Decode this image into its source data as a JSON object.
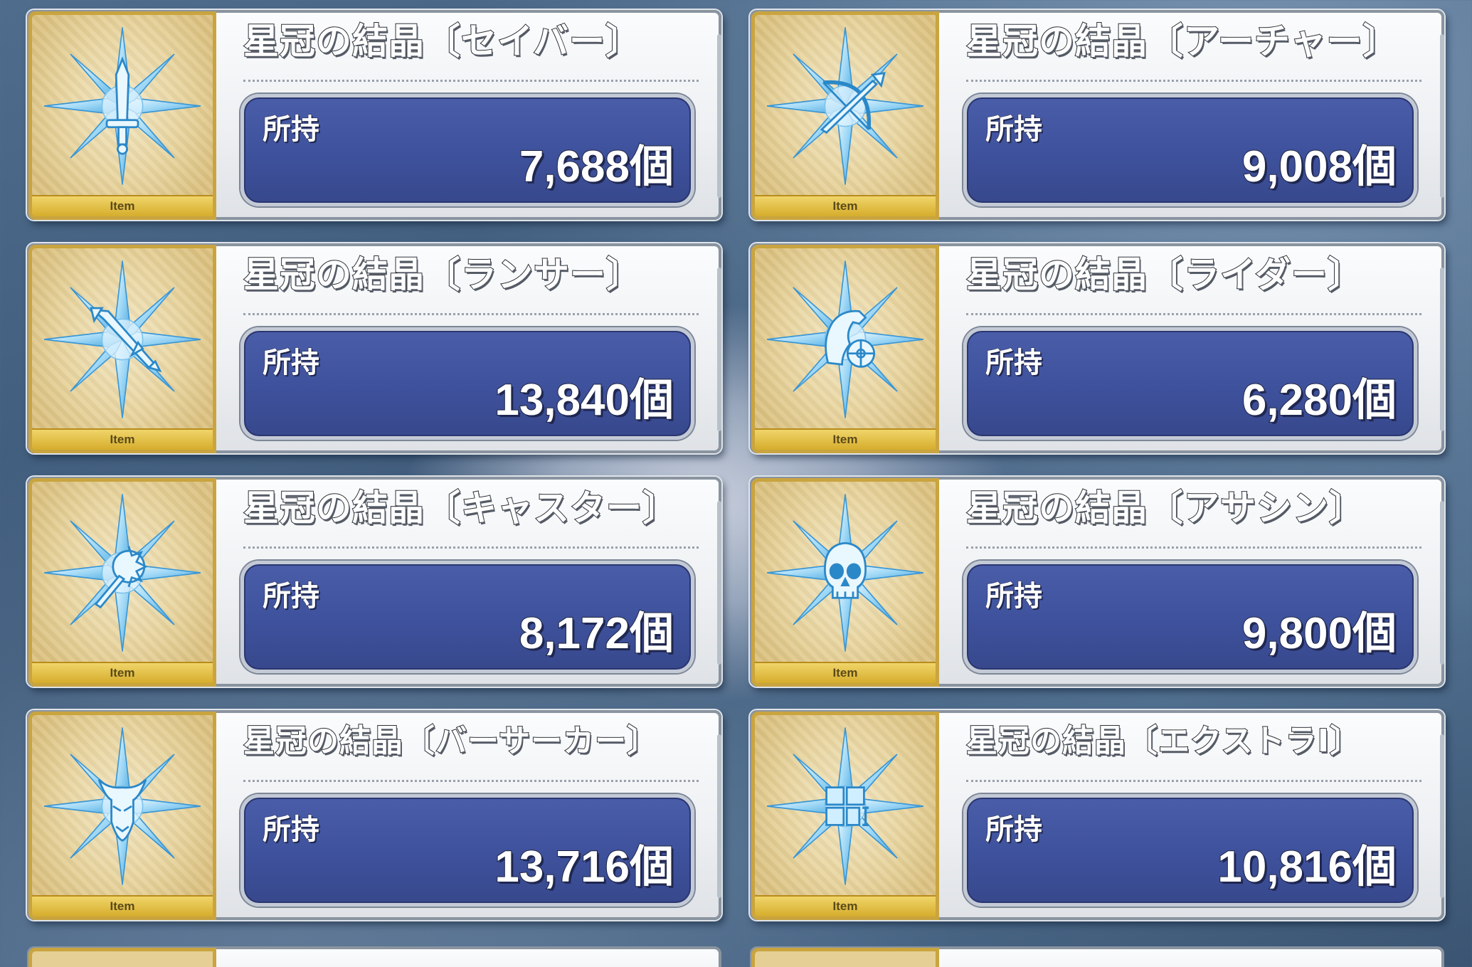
{
  "items": [
    {
      "title": "星冠の結晶〔セイバー〕",
      "owned_label": "所持",
      "count": "7,688個",
      "tag": "Item",
      "icon": "sword-crystal-icon"
    },
    {
      "title": "星冠の結晶〔アーチャー〕",
      "owned_label": "所持",
      "count": "9,008個",
      "tag": "Item",
      "icon": "bow-crystal-icon"
    },
    {
      "title": "星冠の結晶〔ランサー〕",
      "owned_label": "所持",
      "count": "13,840個",
      "tag": "Item",
      "icon": "lance-crystal-icon"
    },
    {
      "title": "星冠の結晶〔ライダー〕",
      "owned_label": "所持",
      "count": "6,280個",
      "tag": "Item",
      "icon": "horse-crystal-icon"
    },
    {
      "title": "星冠の結晶〔キャスター〕",
      "owned_label": "所持",
      "count": "8,172個",
      "tag": "Item",
      "icon": "staff-crystal-icon"
    },
    {
      "title": "星冠の結晶〔アサシン〕",
      "owned_label": "所持",
      "count": "9,800個",
      "tag": "Item",
      "icon": "skull-crystal-icon"
    },
    {
      "title": "星冠の結晶〔バーサーカー〕",
      "owned_label": "所持",
      "count": "13,716個",
      "tag": "Item",
      "icon": "horned-mask-crystal-icon"
    },
    {
      "title": "星冠の結晶〔エクストラⅠ〕",
      "owned_label": "所持",
      "count": "10,816個",
      "tag": "Item",
      "icon": "window-crystal-icon"
    }
  ],
  "colors": {
    "panel_blue": "#3e519c",
    "icon_gold": "#c9a43f",
    "crystal": "#8fd0f4"
  }
}
